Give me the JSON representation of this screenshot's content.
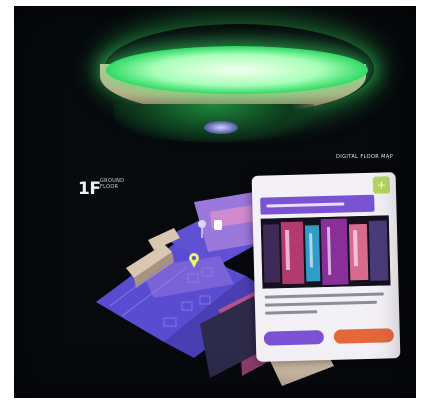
{
  "lamp": {
    "glow_color": "#3ddc6a",
    "body_color": "#c6b294"
  },
  "wall": {
    "floor_number": "1F",
    "floor_caption": "GROUND FLOOR",
    "map_title": "DIGITAL FLOOR MAP"
  },
  "map": {
    "colors": {
      "floor": "#5548c8",
      "walls": "#8f6ed6",
      "pink_block": "#b8538a",
      "beige": "#d9c7b0",
      "pin": "#e9f26c"
    },
    "icons": [
      "location-pin-icon",
      "marker-icon"
    ]
  },
  "info_card": {
    "close_icon": "plus-icon",
    "accent": "#7a52d4",
    "close_color": "#b6d662",
    "button_right_color": "#e5683a"
  }
}
